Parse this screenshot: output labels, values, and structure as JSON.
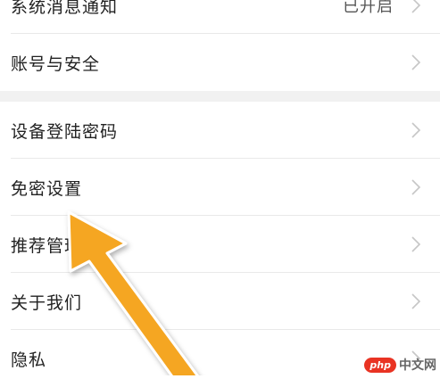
{
  "settings_group_1": {
    "items": [
      {
        "label": "系统消息通知",
        "value": "已开启"
      },
      {
        "label": "账号与安全"
      }
    ]
  },
  "settings_group_2": {
    "items": [
      {
        "label": "设备登陆密码"
      },
      {
        "label": "免密设置"
      },
      {
        "label": "推荐管理"
      },
      {
        "label": "关于我们"
      },
      {
        "label": "隐私"
      }
    ]
  },
  "icons": {
    "chevron": "chevron-right-icon",
    "annotation": "orange-arrow-annotation"
  },
  "colors": {
    "arrow_fill": "#f5a623",
    "separator_band": "#f1f1f1",
    "watermark_logo": "#e93323"
  },
  "watermark": {
    "logo": "php",
    "text": "中文网"
  }
}
